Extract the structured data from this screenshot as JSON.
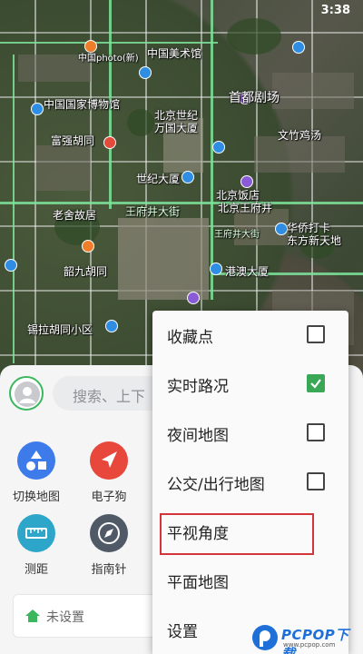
{
  "status_bar": {
    "time": "3:38"
  },
  "map": {
    "labels": [
      "中国美术馆",
      "首都剧场",
      "中国photo(新)",
      "中国国家博物馆",
      "北京世纪",
      "万国大厦",
      "文竹鸡汤",
      "富强胡同",
      "世纪大厦",
      "北京饭店",
      "北京王府井",
      "老舍故居",
      "王府井大街",
      "港澳大厦",
      "华侨打卡",
      "东方新天地",
      "韶九胡同",
      "锡拉胡同小区",
      "王府井大街"
    ]
  },
  "search": {
    "placeholder": "搜索、上下"
  },
  "tools": [
    {
      "label": "切换地图",
      "icon": "shapes-icon"
    },
    {
      "label": "电子狗",
      "icon": "navigation-arrow-icon"
    },
    {
      "label": "测距",
      "icon": "ruler-icon"
    },
    {
      "label": "指南针",
      "icon": "compass-icon"
    }
  ],
  "home": {
    "label": "未设置"
  },
  "menu": {
    "items": [
      {
        "label": "收藏点",
        "checkbox": true,
        "checked": false
      },
      {
        "label": "实时路况",
        "checkbox": true,
        "checked": true
      },
      {
        "label": "夜间地图",
        "checkbox": true,
        "checked": false
      },
      {
        "label": "公交/出行地图",
        "checkbox": true,
        "checked": false
      },
      {
        "label": "平视角度",
        "checkbox": false,
        "highlighted": true
      },
      {
        "label": "平面地图",
        "checkbox": false
      },
      {
        "label": "设置",
        "checkbox": false
      }
    ]
  },
  "watermark": {
    "brand": "PCPOP下载",
    "sub": "www.pcpop.com"
  },
  "colors": {
    "accent_green": "#3aa757",
    "highlight_red": "#d4343a",
    "brand_blue": "#1e6fd8"
  }
}
